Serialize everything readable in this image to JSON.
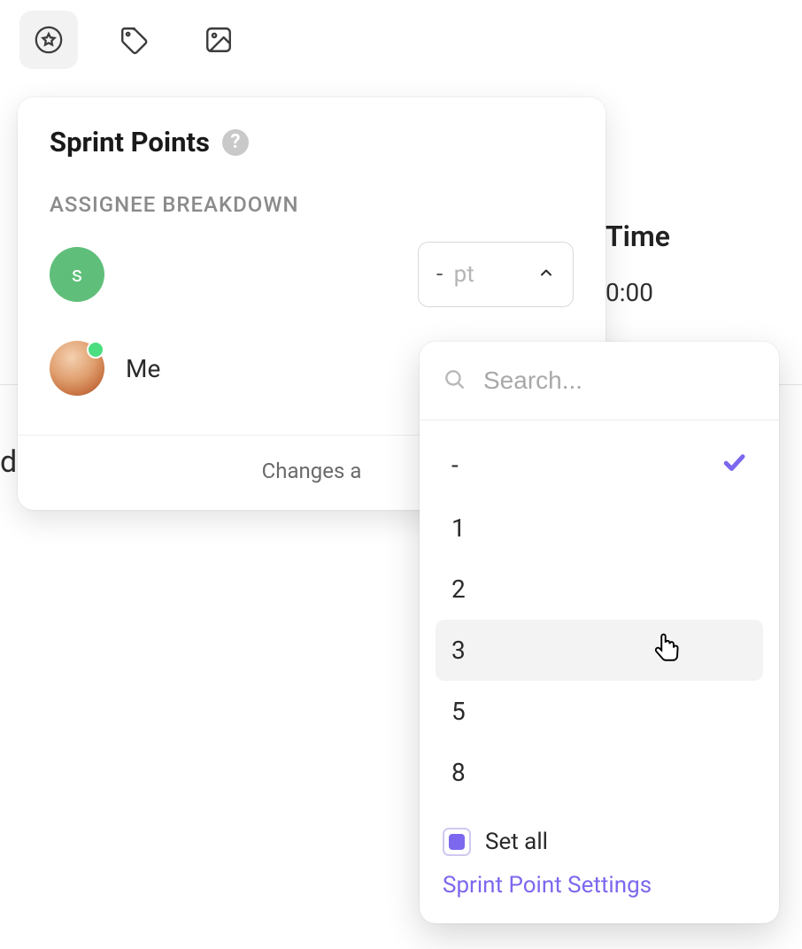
{
  "toolbar": {
    "icons": [
      "star-badge",
      "tag",
      "image"
    ]
  },
  "background": {
    "time_label": "Time",
    "time_value": "0:00",
    "truncated_left": "ds"
  },
  "panel": {
    "title": "Sprint Points",
    "section_label": "ASSIGNEE BREAKDOWN",
    "assignees": [
      {
        "initial": "s",
        "name": "",
        "points_value": "-",
        "points_unit": "pt"
      },
      {
        "name": "Me"
      }
    ],
    "footer_text": "Changes a"
  },
  "dropdown": {
    "search_placeholder": "Search...",
    "options": [
      {
        "label": "-",
        "selected": true,
        "hovered": false
      },
      {
        "label": "1",
        "selected": false,
        "hovered": false
      },
      {
        "label": "2",
        "selected": false,
        "hovered": false
      },
      {
        "label": "3",
        "selected": false,
        "hovered": true
      },
      {
        "label": "5",
        "selected": false,
        "hovered": false
      },
      {
        "label": "8",
        "selected": false,
        "hovered": false
      }
    ],
    "set_all_label": "Set all",
    "set_all_checked": true,
    "settings_link": "Sprint Point Settings"
  }
}
